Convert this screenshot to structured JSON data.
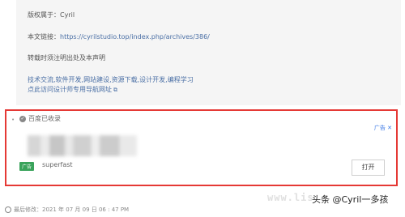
{
  "copyright": {
    "owner_label": "版权属于：",
    "owner": "Cyril",
    "link_label": "本文链接：",
    "link_url": "https://cyrilstudio.top/index.php/archives/386/",
    "notice": "转载时须注明出处及本声明",
    "promo_line1": "技术交流,软件开发,网站建设,资源下载,设计开发,编程学习",
    "promo_line2": "点此访问设计师专用导航网址"
  },
  "ad": {
    "bullet": "•",
    "baidu_included": "百度已收录",
    "ad_tag": "广告 ✕",
    "badge": "广告",
    "source": "superfast",
    "open_button": "打开"
  },
  "footer": {
    "last_modified": "最后修改：2021 年 07 月 09 日 06 : 47 PM"
  },
  "watermark": {
    "site": "www.lis",
    "channel": "头条 @Cyril一多孩"
  }
}
